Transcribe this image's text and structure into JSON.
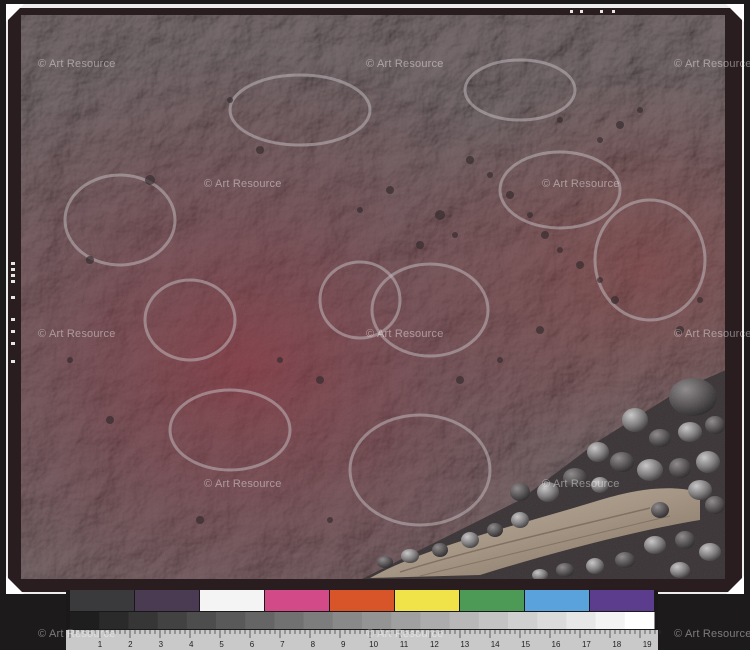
{
  "watermark": {
    "text": "© Art Resource"
  },
  "target_strip": {
    "color_patches": [
      "#3a3a3c",
      "#4b3b52",
      "#f4f4f4",
      "#d34a88",
      "#d8552a",
      "#f0e34a",
      "#4c9a56",
      "#5aa2dc",
      "#5c3c8c"
    ],
    "scale_numbers": [
      "1",
      "2",
      "3",
      "4",
      "5",
      "6",
      "7",
      "8",
      "9",
      "10",
      "11",
      "12",
      "13",
      "14",
      "15",
      "16",
      "17",
      "18",
      "19"
    ]
  },
  "colors": {
    "rock_base": "#6e6264",
    "rock_red": "#7a3c3e",
    "rock_light": "#a9a4a6",
    "frame_dark": "#2a1d20",
    "page_bg": "#1c1a1b"
  }
}
